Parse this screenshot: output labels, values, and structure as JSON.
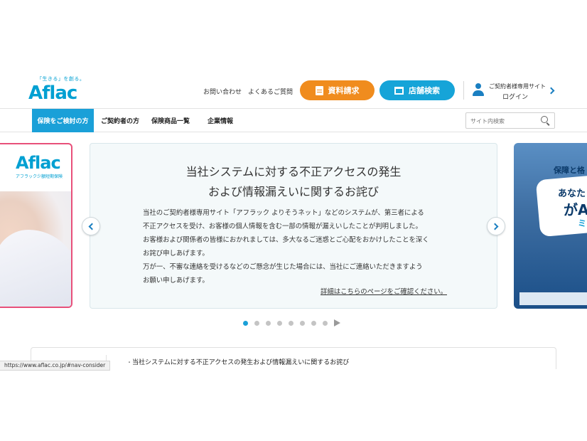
{
  "header": {
    "logo_tagline": "「生きる」を創る。",
    "logo_text": "Aflac",
    "contact_link": "お問い合わせ",
    "faq_link": "よくあるご質問",
    "request_docs_button": "資料請求",
    "store_search_button": "店舗検索",
    "member_site_label": "ご契約者様専用サイト",
    "member_login": "ログイン"
  },
  "nav": {
    "items": [
      {
        "label": "保険をご検討の方"
      },
      {
        "label": "ご契約者の方"
      },
      {
        "label": "保険商品一覧"
      },
      {
        "label": "企業情報"
      }
    ],
    "search_placeholder": "サイト内検索"
  },
  "carousel": {
    "left_slide": {
      "brand": "Aflac",
      "subtitle": "アフラック少額短期保険"
    },
    "main_slide": {
      "title_line1": "当社システムに対する不正アクセスの発生",
      "title_line2": "および情報漏えいに関するお詫び",
      "body_lines": [
        "当社のご契約者様専用サイト「アフラック よりそうネット」などのシステムが、第三者による",
        "不正アクセスを受け、お客様の個人情報を含む一部の情報が漏えいしたことが判明しました。",
        "お客様および関係者の皆様におかれましては、多大なるご迷惑とご心配をおかけしたことを深く",
        "お詫び申しあげます。",
        "万が一、不審な連絡を受けるなどのご懸念が生じた場合には、当社にご連絡いただきますよう",
        "お願い申しあげます。"
      ],
      "details_link": "詳細はこちらのページをご確認ください。"
    },
    "right_slide": {
      "heading": "保障と格",
      "big_line1": "あなた",
      "big_line2": "がA",
      "big_line3": "ミ"
    },
    "dot_count": 8,
    "active_dot": 0
  },
  "news": {
    "bullet": "・",
    "first_item": "当社システムに対する不正アクセスの発生および情報漏えいに関するお詫び"
  },
  "status_bar": {
    "url": "https://www.aflac.co.jp/#nav-consider"
  },
  "colors": {
    "brand_blue": "#00a0d2",
    "orange": "#f08c1e",
    "nav_active": "#1aa0d8"
  }
}
